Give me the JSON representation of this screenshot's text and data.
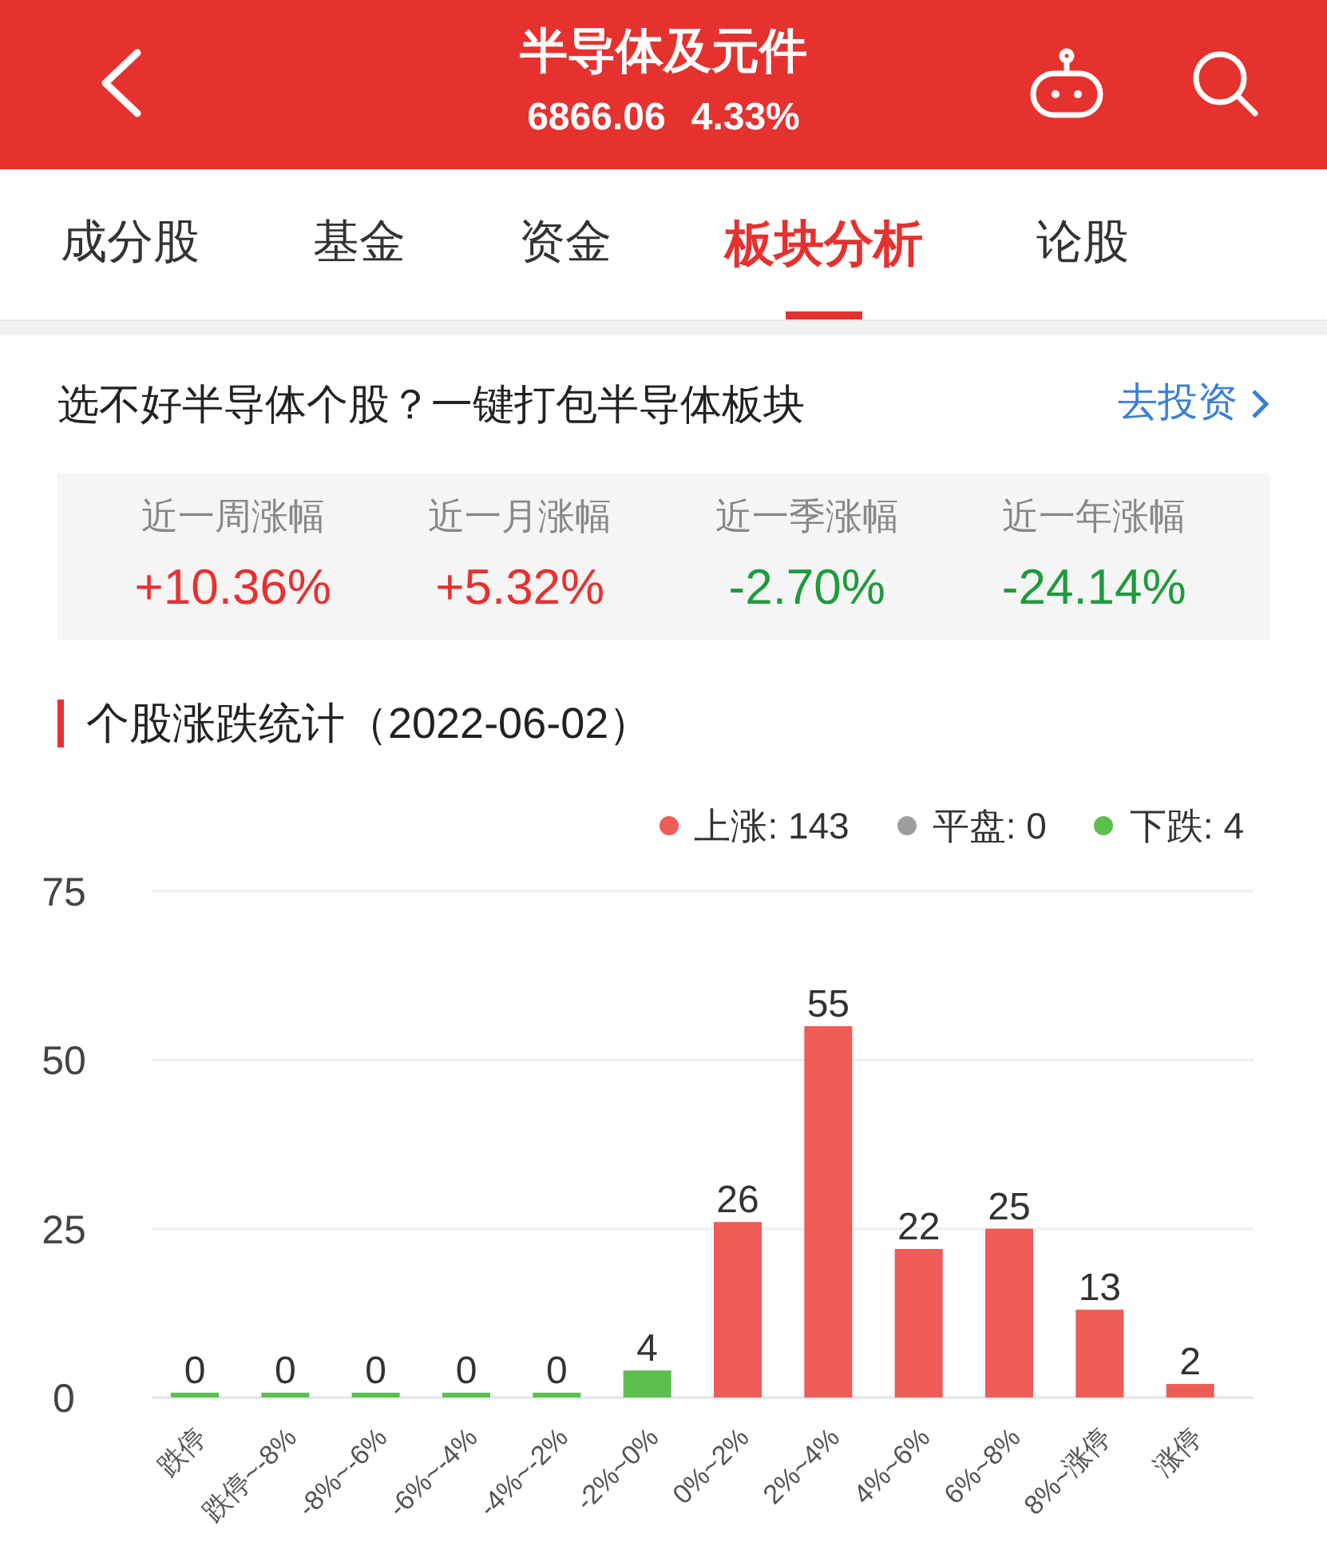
{
  "header": {
    "title": "半导体及元件",
    "price": "6866.06",
    "change": "4.33%"
  },
  "tabs": [
    {
      "label": "成分股",
      "selected": false
    },
    {
      "label": "基金",
      "selected": false
    },
    {
      "label": "资金",
      "selected": false
    },
    {
      "label": "板块分析",
      "selected": true
    },
    {
      "label": "论股",
      "selected": false
    }
  ],
  "promo": {
    "text": "选不好半导体个股？一键打包半导体板块",
    "link": "去投资"
  },
  "stats": [
    {
      "label": "近一周涨幅",
      "value": "+10.36%",
      "color": "#e93030"
    },
    {
      "label": "近一月涨幅",
      "value": "+5.32%",
      "color": "#e93030"
    },
    {
      "label": "近一季涨幅",
      "value": "-2.70%",
      "color": "#1e9b3c"
    },
    {
      "label": "近一年涨幅",
      "value": "-24.14%",
      "color": "#1e9b3c"
    }
  ],
  "section_title": "个股涨跌统计（2022-06-02）",
  "legend": [
    {
      "label": "上涨: 143",
      "color": "#ef5b55"
    },
    {
      "label": "平盘: 0",
      "color": "#9e9e9e"
    },
    {
      "label": "下跌: 4",
      "color": "#5cbf4c"
    }
  ],
  "chart_data": {
    "type": "bar",
    "data_labels": true,
    "ylim": [
      0,
      75
    ],
    "yticks": [
      0,
      25,
      50,
      75
    ],
    "categories": [
      "跌停",
      "跌停~-8%",
      "-8%~-6%",
      "-6%~-4%",
      "-4%~-2%",
      "-2%~0%",
      "0%~2%",
      "2%~4%",
      "4%~6%",
      "6%~8%",
      "8%~涨停",
      "涨停"
    ],
    "series": [
      {
        "color": "#5cbf4c",
        "values": [
          0,
          0,
          0,
          0,
          0,
          4,
          null,
          null,
          null,
          null,
          null,
          null
        ]
      },
      {
        "color": "#ef5b55",
        "values": [
          null,
          null,
          null,
          null,
          null,
          null,
          26,
          55,
          22,
          25,
          13,
          2
        ]
      }
    ]
  }
}
